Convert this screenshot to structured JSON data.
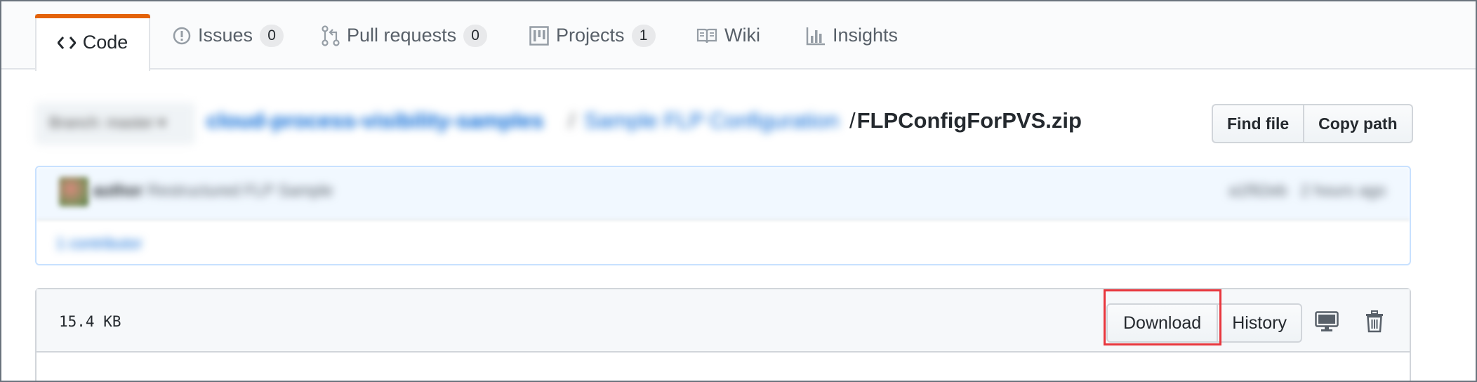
{
  "tabs": [
    {
      "label": "Code",
      "icon": "code-icon",
      "selected": true
    },
    {
      "label": "Issues",
      "icon": "issue-opened-icon",
      "count": "0"
    },
    {
      "label": "Pull requests",
      "icon": "git-pull-request-icon",
      "count": "0"
    },
    {
      "label": "Projects",
      "icon": "project-icon",
      "count": "1"
    },
    {
      "label": "Wiki",
      "icon": "book-icon"
    },
    {
      "label": "Insights",
      "icon": "graph-icon"
    }
  ],
  "breadcrumb": {
    "branch_label": "Branch: master ▾",
    "repo": "cloud-process-visibility-samples",
    "separator": "/",
    "folder": "Sample FLP Configuration",
    "slash": "/",
    "filename": "FLPConfigForPVS.zip"
  },
  "file_nav": {
    "find_file": "Find file",
    "copy_path": "Copy path"
  },
  "commit": {
    "author": "author",
    "message": "Restructured FLP Sample",
    "sha": "a1f92eb",
    "time": "2 hours ago",
    "contributors": "1 contributor"
  },
  "file": {
    "size": "15.4 KB",
    "download_label": "Download",
    "history_label": "History",
    "desktop_icon": "device-desktop-icon",
    "delete_icon": "trashcan-icon"
  },
  "colors": {
    "accent_tab": "#e36209",
    "highlight_box": "#e8363d",
    "link": "#0366d6"
  }
}
